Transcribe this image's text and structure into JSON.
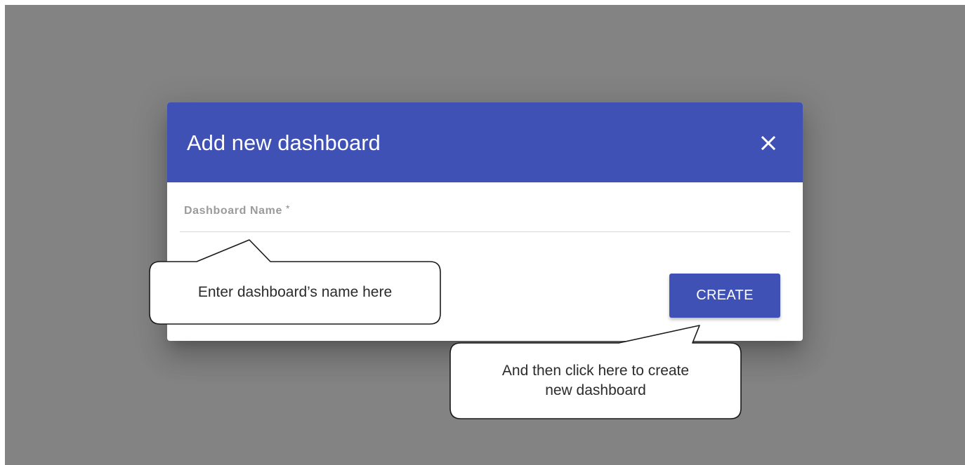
{
  "dialog": {
    "title": "Add new dashboard",
    "close_icon": "close-icon",
    "field": {
      "label": "Dashboard Name",
      "required_marker": "*",
      "value": ""
    },
    "create_label": "CREATE"
  },
  "callouts": {
    "name_hint": "Enter dashboard’s name here",
    "create_hint_line1": "And then click here to create",
    "create_hint_line2": "new dashboard"
  },
  "colors": {
    "overlay": "#838383",
    "primary": "#3f51b5",
    "surface": "#ffffff"
  }
}
